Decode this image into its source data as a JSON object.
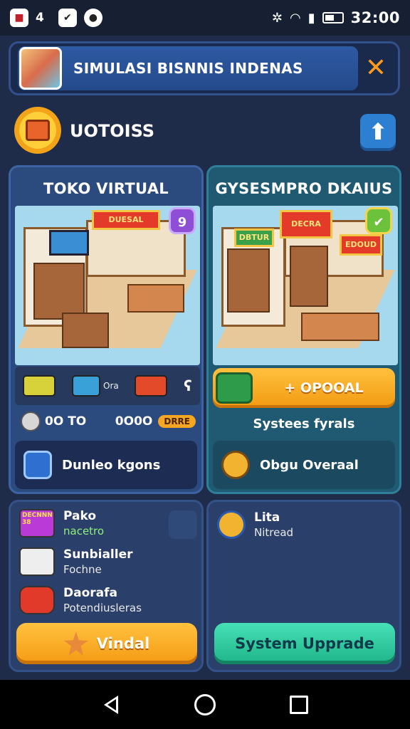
{
  "status_bar": {
    "notification_count": "4",
    "time": "32:00",
    "icons": [
      "app-notification-icon",
      "shield-icon",
      "chat-icon",
      "settings-icon",
      "wifi-icon",
      "signal-icon",
      "battery-icon"
    ]
  },
  "title_bar": {
    "title": "SIMULASI BISNNIS INDENAS",
    "close_label": "✕"
  },
  "section": {
    "title": "UOTOISS",
    "upload_label": "⬆"
  },
  "left_panel": {
    "heading": "TOKO VIRTUAL",
    "sign_text": "DUESAL",
    "badge": "9",
    "item_label": "Ora",
    "cost_left": "0O TO",
    "cost_right": "0O0O",
    "pill": "DRRE",
    "info_label": "Dunleo kgons"
  },
  "right_panel": {
    "heading": "GYSESMPRO DKAIUS",
    "sign_text": "DECRA",
    "sign_text_2": "EDOUD",
    "sign_text_3": "DBTUR",
    "upgrade_label": "+ OPOOAL",
    "subline": "Systees fyrals",
    "info_label": "Obgu Overaal"
  },
  "bottom_left": {
    "items": [
      {
        "title": "Pako",
        "subtitle": "nacetro",
        "icon": "tag-icon",
        "tag": "DECNNN 38"
      },
      {
        "title": "Sunbialler",
        "subtitle": "Fochne",
        "icon": "dice-icon"
      },
      {
        "title": "Daorafa",
        "subtitle": "Potendiusleras",
        "icon": "gamepad-icon"
      }
    ],
    "button_label": "Vindal"
  },
  "bottom_right": {
    "items": [
      {
        "title": "Lita",
        "subtitle": "Nitread",
        "icon": "gear-icon"
      }
    ],
    "button_label": "System Upprade"
  },
  "colors": {
    "background": "#1f2c49",
    "accent_orange": "#f59a14",
    "accent_green": "#1fb489",
    "panel_blue": "#2b4a7e",
    "panel_teal": "#1f5a72"
  }
}
